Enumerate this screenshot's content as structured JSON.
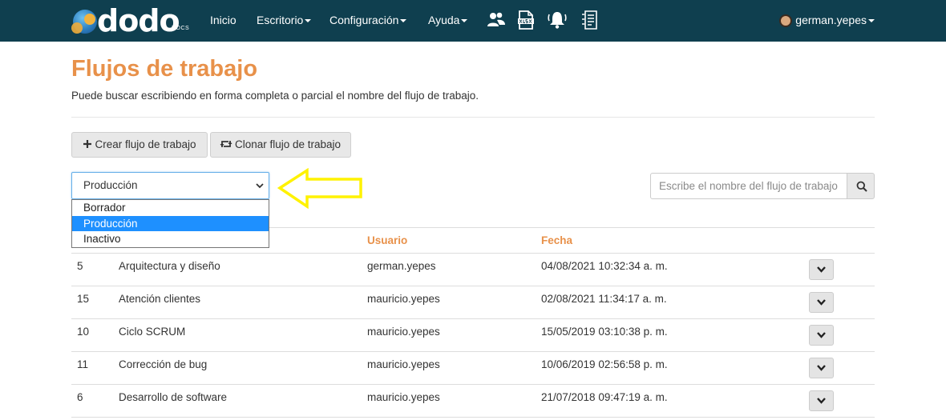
{
  "navbar": {
    "logo_text": "dodo",
    "logo_sub": "DOCS",
    "items": [
      {
        "label": "Inicio",
        "has_caret": false
      },
      {
        "label": "Escritorio",
        "has_caret": true
      },
      {
        "label": "Configuración",
        "has_caret": true
      },
      {
        "label": "Ayuda",
        "has_caret": true
      }
    ],
    "icons": [
      "users-icon",
      "xlsx-file-icon",
      "bell-icon",
      "document-list-icon"
    ],
    "user": "german.yepes"
  },
  "header": {
    "title": "Flujos de trabajo",
    "subtitle": "Puede buscar escribiendo en forma completa o parcial el nombre del flujo de trabajo."
  },
  "toolbar": {
    "create_label": "Crear flujo de trabajo",
    "clone_label": "Clonar flujo de trabajo"
  },
  "status_filter": {
    "selected": "Producción",
    "options": [
      "Borrador",
      "Producción",
      "Inactivo"
    ]
  },
  "search": {
    "placeholder": "Escribe el nombre del flujo de trabajo"
  },
  "table": {
    "columns": [
      "Usuario",
      "Fecha"
    ],
    "rows": [
      {
        "id": "5",
        "name": "Arquitectura y diseño",
        "user": "german.yepes",
        "date": "04/08/2021 10:32:34 a. m."
      },
      {
        "id": "15",
        "name": "Atención clientes",
        "user": "mauricio.yepes",
        "date": "02/08/2021 11:34:17 a. m."
      },
      {
        "id": "10",
        "name": "Ciclo SCRUM",
        "user": "mauricio.yepes",
        "date": "15/05/2019 03:10:38 p. m."
      },
      {
        "id": "11",
        "name": "Corrección de bug",
        "user": "mauricio.yepes",
        "date": "10/06/2019 02:56:58 p. m."
      },
      {
        "id": "6",
        "name": "Desarrollo de software",
        "user": "mauricio.yepes",
        "date": "21/07/2018 09:47:19 a. m."
      }
    ]
  },
  "colors": {
    "navbar_bg": "#0f3f4f",
    "accent_orange": "#e8914a",
    "selected_option": "#1e90ff",
    "arrow_yellow": "#fff200"
  }
}
